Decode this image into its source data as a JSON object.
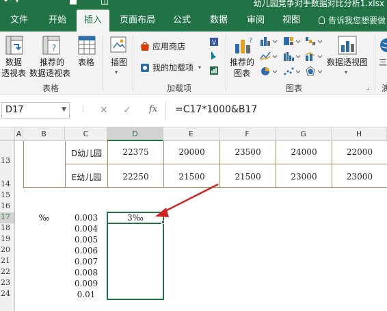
{
  "window": {
    "title": "幼儿园竞争对手数据对比分析1.xlsx",
    "brand_color": "#217346"
  },
  "quick_access": [
    {
      "name": "undo-icon",
      "glyph": "↶"
    },
    {
      "name": "save-icon",
      "glyph": "■"
    },
    {
      "name": "preview-icon",
      "glyph": "◫"
    }
  ],
  "tabs": [
    {
      "name": "file",
      "label": "文件",
      "active": false
    },
    {
      "name": "home",
      "label": "开始",
      "active": false
    },
    {
      "name": "insert",
      "label": "插入",
      "active": true
    },
    {
      "name": "page-layout",
      "label": "页面布局",
      "active": false
    },
    {
      "name": "formulas",
      "label": "公式",
      "active": false
    },
    {
      "name": "data",
      "label": "数据",
      "active": false
    },
    {
      "name": "review",
      "label": "审阅",
      "active": false
    },
    {
      "name": "view",
      "label": "视图",
      "active": false
    }
  ],
  "tell_me": "告诉我您想要做",
  "ribbon": {
    "pivot_table_1": "数据",
    "pivot_table_2": "透视表",
    "recommended_pivot_1": "推荐的",
    "recommended_pivot_2": "数据透视表",
    "table": "表格",
    "group_tables": "表格",
    "illustrations": "插图",
    "app_store": "应用商店",
    "my_addins": "我的加载项",
    "group_addins": "加载项",
    "recommended_charts_1": "推荐的",
    "recommended_charts_2": "图表",
    "pivot_chart": "数据透视图",
    "three_d_map": "三维",
    "group_charts": "图表",
    "group_tours": "演"
  },
  "formula_bar": {
    "name_box": "D17",
    "cancel_glyph": "✕",
    "enter_glyph": "✓",
    "fx": "fx",
    "formula": "=C17*1000&B17"
  },
  "columns": [
    "A",
    "B",
    "C",
    "D",
    "E",
    "F",
    "G",
    "H"
  ],
  "selected_column": "D",
  "rows": [
    "13",
    "14",
    "15",
    "16",
    "17",
    "18",
    "19",
    "20",
    "21",
    "22",
    "23",
    "24"
  ],
  "selected_row": "17",
  "table": {
    "row13": {
      "label": "D幼儿园",
      "values": [
        "22375",
        "20000",
        "23500",
        "24000",
        "22000"
      ]
    },
    "row14": {
      "label": "E幼儿园",
      "values": [
        "22250",
        "21500",
        "21500",
        "23000",
        "23000"
      ]
    }
  },
  "b17": "‰",
  "c_values": [
    "0.003",
    "0.004",
    "0.005",
    "0.006",
    "0.007",
    "0.008",
    "0.009",
    "0.01"
  ],
  "d17": "3‰",
  "annotation_color": "#d42121"
}
